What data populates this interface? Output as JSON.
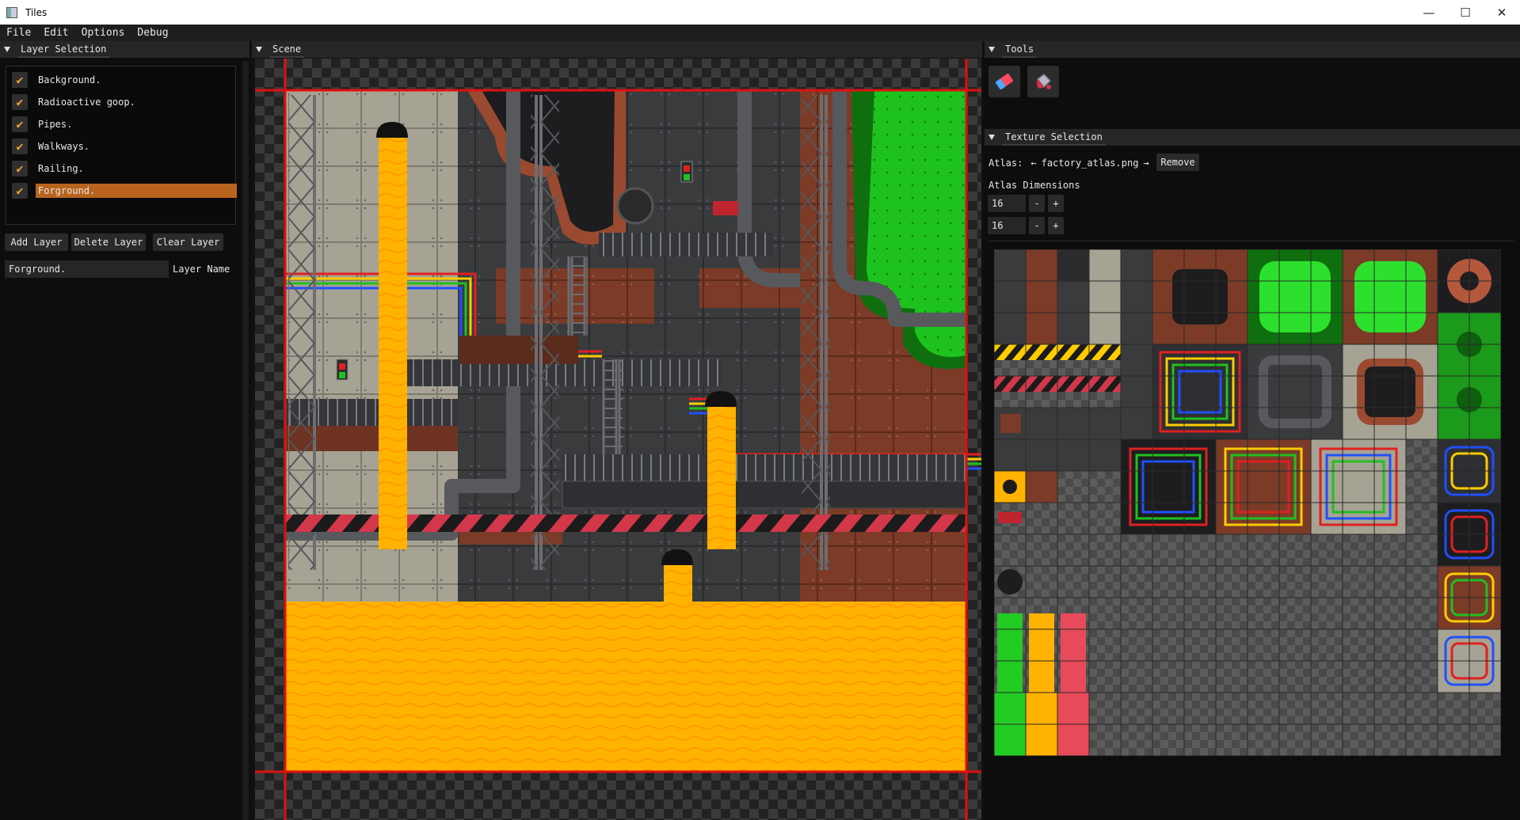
{
  "window": {
    "title": "Tiles",
    "minimize": "—",
    "maximize": "☐",
    "close": "✕"
  },
  "menu": {
    "items": [
      "File",
      "Edit",
      "Options",
      "Debug"
    ]
  },
  "layer_panel": {
    "title": "Layer Selection",
    "layers": [
      {
        "name": "Background.",
        "checked": true
      },
      {
        "name": "Radioactive goop.",
        "checked": true
      },
      {
        "name": "Pipes.",
        "checked": true
      },
      {
        "name": "Walkways.",
        "checked": true
      },
      {
        "name": "Railing.",
        "checked": true
      },
      {
        "name": "Forground.",
        "checked": true,
        "selected": true
      }
    ],
    "check_glyph": "✔",
    "add_layer": "Add Layer",
    "delete_layer": "Delete Layer",
    "clear_layer": "Clear Layer",
    "layer_name_value": "Forground.",
    "layer_name_label": "Layer Name"
  },
  "scene_panel": {
    "title": "Scene"
  },
  "tools_panel": {
    "title": "Tools",
    "tools": [
      "eraser-icon",
      "fill-bucket-icon"
    ]
  },
  "texture_panel": {
    "title": "Texture Selection",
    "atlas_label": "Atlas:",
    "atlas_file": "factory_atlas.png",
    "remove_label": "Remove",
    "dimensions_label": "Atlas Dimensions",
    "dim_x": "16",
    "dim_y": "16",
    "minus": "-",
    "plus": "+"
  },
  "colors": {
    "accent_selected": "#b8641e",
    "check_orange": "#f0a030",
    "scene_border": "#e01010",
    "lava": "#ffb300",
    "goop_green": "#22cc22",
    "rust": "#7a3a26",
    "metal": "#3c3c3c",
    "concrete": "#a8a496"
  }
}
